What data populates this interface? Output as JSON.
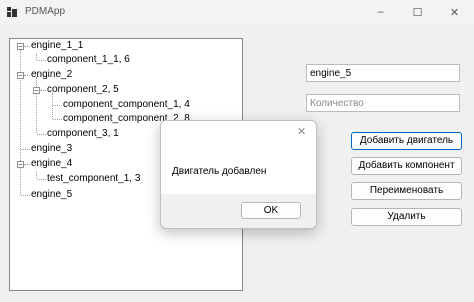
{
  "window": {
    "title": "PDMApp",
    "controls": {
      "minimize": "–",
      "maximize": "☐",
      "close": "✕"
    }
  },
  "tree": {
    "nodes": [
      {
        "label": "engine_1_1",
        "expander": "−"
      },
      {
        "label": "component_1_1, 6"
      },
      {
        "label": "engine_2",
        "expander": "−"
      },
      {
        "label": "component_2, 5",
        "expander": "−"
      },
      {
        "label": "component_component_1, 4"
      },
      {
        "label": "component_component_2, 8"
      },
      {
        "label": "component_3, 1"
      },
      {
        "label": "engine_3"
      },
      {
        "label": "engine_4",
        "expander": "−"
      },
      {
        "label": "test_component_1, 3"
      },
      {
        "label": "engine_5"
      }
    ]
  },
  "form": {
    "name_value": "engine_5",
    "quantity_placeholder": "Количество"
  },
  "buttons": {
    "add_engine": "Добавить двигатель",
    "add_component": "Добавить компонент",
    "rename": "Переименовать",
    "delete": "Удалить"
  },
  "dialog": {
    "message": "Двигатель добавлен",
    "ok": "OK",
    "close": "✕"
  },
  "colors": {
    "accent": "#0067c0"
  }
}
